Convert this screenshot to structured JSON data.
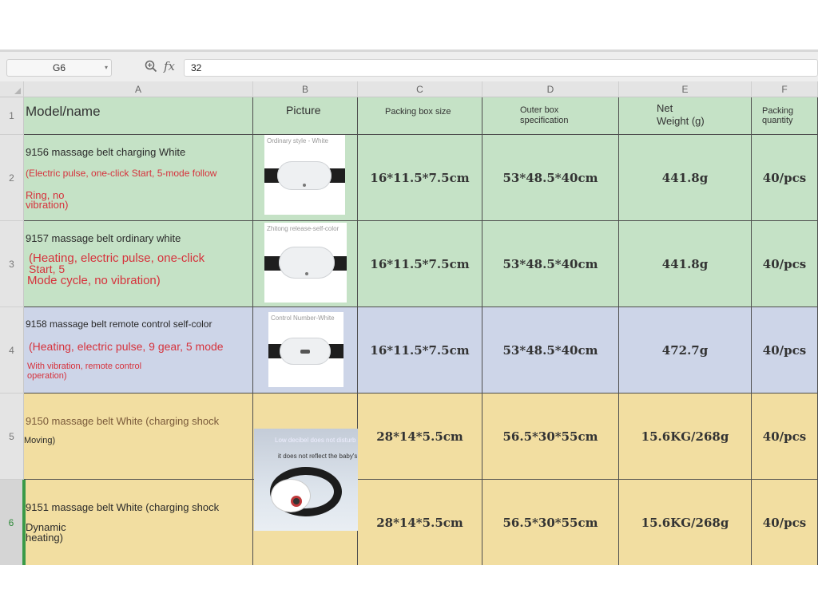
{
  "formula_bar": {
    "cell_ref": "G6",
    "fx_label": "fx",
    "value": "32"
  },
  "columns": [
    "A",
    "B",
    "C",
    "D",
    "E",
    "F"
  ],
  "rows": [
    "1",
    "2",
    "3",
    "4",
    "5",
    "6"
  ],
  "header": {
    "model": "Model/name",
    "picture": "Picture",
    "packing_box": "Packing box size",
    "outer_box_1": "Outer box",
    "outer_box_2": "specification",
    "net_weight_1": "Net",
    "net_weight_2": "Weight (g)",
    "packing_qty_1": "Packing",
    "packing_qty_2": "quantity"
  },
  "items": [
    {
      "name": "9156 massage belt charging White",
      "desc1": " (Electric pulse, one-click Start, 5-mode follow",
      "desc2": "Ring, no",
      "desc3": "vibration)",
      "image_caption": "Ordinary style - White",
      "box": "16*11.5*7.5cm",
      "outer": "53*48.5*40cm",
      "weight": "441.8g",
      "qty": "40/pcs"
    },
    {
      "name": "9157 massage belt ordinary white",
      "desc1": "(Heating, electric pulse, one-click",
      "desc2": "Start, 5",
      "desc3": "Mode cycle, no vibration)",
      "image_caption": "Zhitong release-self-color",
      "box": "16*11.5*7.5cm",
      "outer": "53*48.5*40cm",
      "weight": "441.8g",
      "qty": "40/pcs"
    },
    {
      "name": "9158 massage belt remote control self-color",
      "desc1": "(Heating, electric pulse, 9 gear, 5 mode",
      "desc2": "With vibration, remote control",
      "desc3": "operation)",
      "image_caption": "Control Number-White",
      "box": "16*11.5*7.5cm",
      "outer": "53*48.5*40cm",
      "weight": "472.7g",
      "qty": "40/pcs"
    },
    {
      "name": "9150 massage belt White (charging shock",
      "desc1": "Moving)",
      "box": "28*14*5.5cm",
      "outer": "56.5*30*55cm",
      "weight": "15.6KG/268g",
      "qty": "40/pcs"
    },
    {
      "name": "9151 massage belt White (charging shock",
      "desc1": "Dynamic",
      "desc2": "heating)",
      "box": "28*14*5.5cm",
      "outer": "56.5*30*55cm",
      "weight": "15.6KG/268g",
      "qty": "40/pcs"
    }
  ],
  "lifestyle_image": {
    "line1": "Low decibel does not disturb",
    "line2": "it does not reflect the baby's sleep at all."
  },
  "colors": {
    "green": "#c5e2c6",
    "blue": "#cdd5e8",
    "yellow": "#f2dea1",
    "red_text": "#d6323c"
  }
}
